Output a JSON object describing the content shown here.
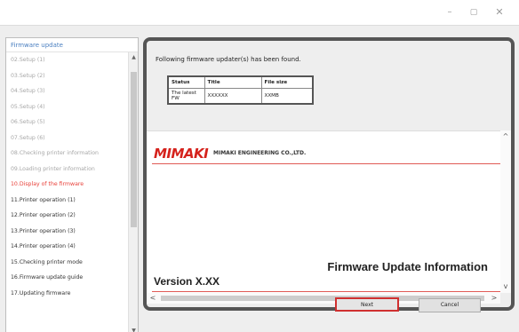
{
  "window": {
    "minimize_glyph": "–",
    "maximize_glyph": "▢",
    "close_glyph": "✕"
  },
  "sidebar": {
    "header": "Firmware update",
    "items": [
      {
        "label": "02.Setup (1)",
        "state": "done"
      },
      {
        "label": "03.Setup (2)",
        "state": "done"
      },
      {
        "label": "04.Setup (3)",
        "state": "done"
      },
      {
        "label": "05.Setup (4)",
        "state": "done"
      },
      {
        "label": "06.Setup (5)",
        "state": "done"
      },
      {
        "label": "07.Setup (6)",
        "state": "done"
      },
      {
        "label": "08.Checking printer information",
        "state": "done"
      },
      {
        "label": "09.Loading printer information",
        "state": "done"
      },
      {
        "label": "10.Display of the firmware",
        "state": "current"
      },
      {
        "label": "11.Printer operation (1)",
        "state": "todo"
      },
      {
        "label": "12.Printer operation (2)",
        "state": "todo"
      },
      {
        "label": "13.Printer operation (3)",
        "state": "todo"
      },
      {
        "label": "14.Printer operation (4)",
        "state": "todo"
      },
      {
        "label": "15.Checking printer mode",
        "state": "todo"
      },
      {
        "label": "16.Firmware update guide",
        "state": "todo"
      },
      {
        "label": "17.Updating firmware",
        "state": "todo"
      }
    ],
    "scroll_up": "▲",
    "scroll_down": "▼"
  },
  "content": {
    "message": "Following firmware updater(s) has been found.",
    "table": {
      "headers": [
        "Status",
        "Title",
        "File size"
      ],
      "rows": [
        [
          "The latest FW",
          "XXXXXX",
          "XXMB"
        ]
      ]
    },
    "document": {
      "logo": "MIMAKI",
      "company": "MIMAKI ENGINEERING CO.,LTD.",
      "heading": "Firmware Update Information",
      "version": "Version X.XX"
    },
    "scroll": {
      "up": "^",
      "down": "v",
      "left": "<",
      "right": ">"
    }
  },
  "buttons": {
    "next": "Next",
    "cancel": "Cancel"
  },
  "colors": {
    "current_step": "#e8413a",
    "done_step": "#a7a7a7",
    "sidebar_header": "#4a7fc0",
    "logo": "#d5221c",
    "next_highlight": "#d03030"
  }
}
